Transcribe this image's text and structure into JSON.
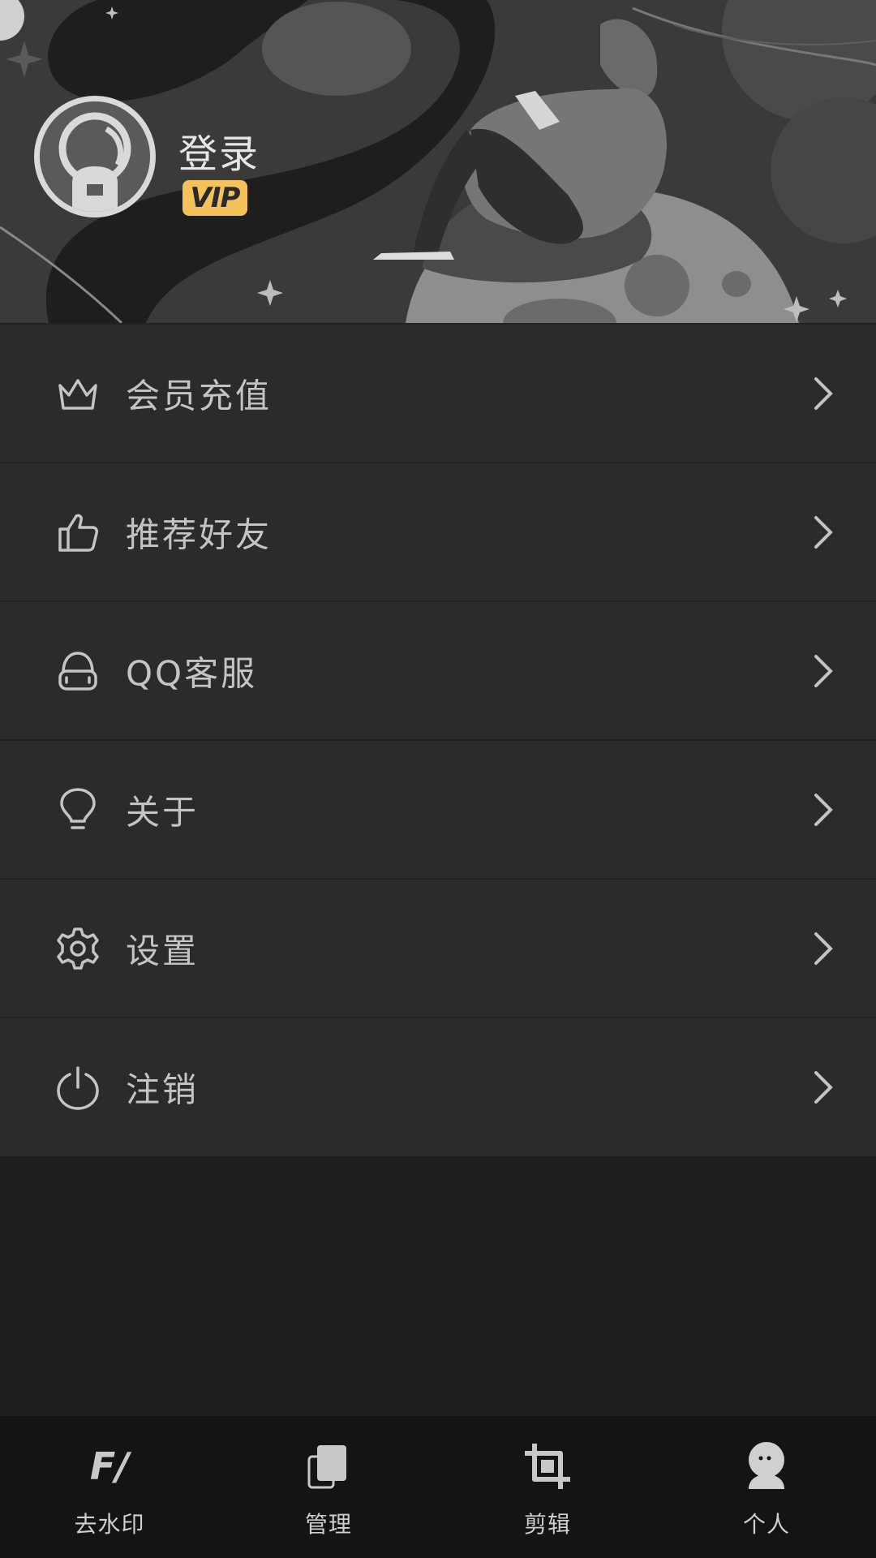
{
  "header": {
    "login_label": "登录",
    "vip_badge": "VIP"
  },
  "menu": {
    "items": [
      {
        "label": "会员充值",
        "icon": "crown-icon"
      },
      {
        "label": "推荐好友",
        "icon": "thumbs-up-icon"
      },
      {
        "label": "QQ客服",
        "icon": "headset-icon"
      },
      {
        "label": "关于",
        "icon": "lightbulb-icon"
      },
      {
        "label": "设置",
        "icon": "gear-icon"
      },
      {
        "label": "注销",
        "icon": "power-icon"
      }
    ]
  },
  "bottom_nav": {
    "items": [
      {
        "label": "去水印",
        "icon": "watermark-icon"
      },
      {
        "label": "管理",
        "icon": "files-icon"
      },
      {
        "label": "剪辑",
        "icon": "crop-icon"
      },
      {
        "label": "个人",
        "icon": "person-icon"
      }
    ],
    "active_index": 3
  },
  "colors": {
    "background": "#1f1f1f",
    "menu_bg": "#2b2b2b",
    "vip_yellow": "#f5c15a",
    "nav_bg": "#141414"
  }
}
